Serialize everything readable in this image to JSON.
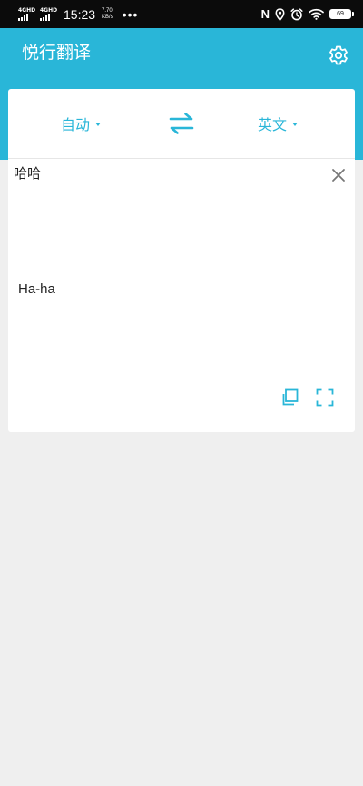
{
  "status_bar": {
    "signal1_label": "4GHD",
    "signal2_label": "4GHD",
    "time": "15:23",
    "speed_value": "7.70",
    "speed_unit": "KB/s",
    "more": "•••",
    "nfc": "N",
    "battery": "69"
  },
  "header": {
    "title": "悦行翻译"
  },
  "languages": {
    "source": "自动",
    "target": "英文"
  },
  "translation": {
    "source_text": "哈哈",
    "result_text": "Ha-ha"
  },
  "colors": {
    "accent": "#29b6d8",
    "background": "#efefef",
    "status_bar": "#0b0b0b"
  },
  "icons": {
    "settings": "gear-icon",
    "swap": "swap-arrows-icon",
    "clear": "close-icon",
    "copy": "copy-icon",
    "fullscreen": "fullscreen-icon"
  }
}
